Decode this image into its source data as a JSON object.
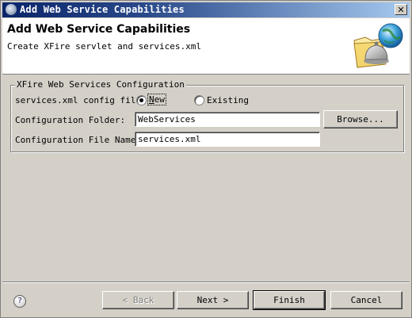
{
  "window": {
    "title": "Add Web Service Capabilities",
    "close_glyph": "✕"
  },
  "banner": {
    "title": "Add Web Service Capabilities",
    "subtitle": "Create XFire servlet and services.xml"
  },
  "group": {
    "legend": "XFire Web Services Configuration",
    "config_file_label": "services.xml config file",
    "radio_new": {
      "label": "New",
      "mnemonic": "N",
      "rest": "ew",
      "checked": true
    },
    "radio_existing": {
      "label": "Existing",
      "checked": false
    },
    "folder_label": "Configuration Folder:",
    "folder_value": "WebServices",
    "browse_label": "Browse...",
    "file_name_label": "Configuration File Name:",
    "file_name_value": "services.xml"
  },
  "footer": {
    "help_glyph": "?",
    "back_label": "< Back",
    "next_label": "Next >",
    "finish_label": "Finish",
    "cancel_label": "Cancel"
  },
  "icons": {
    "title": "app-icon",
    "banner": "web-service-wizard-icon",
    "help": "help-icon"
  }
}
